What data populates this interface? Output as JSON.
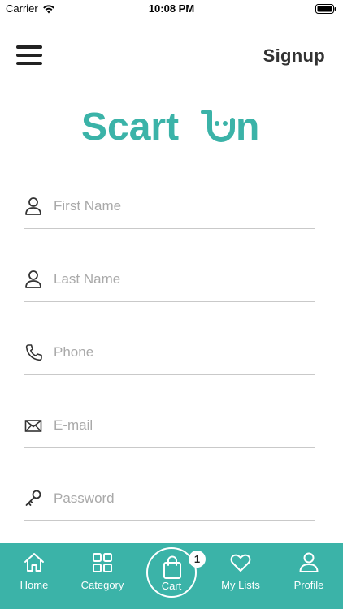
{
  "status_bar": {
    "carrier": "Carrier",
    "time": "10:08 PM"
  },
  "header": {
    "title": "Signup",
    "menu_icon": "hamburger-menu-icon"
  },
  "logo": {
    "text": "Scartᴗn"
  },
  "form": {
    "fields": [
      {
        "icon": "person-icon",
        "placeholder": "First Name",
        "value": ""
      },
      {
        "icon": "person-icon",
        "placeholder": "Last Name",
        "value": ""
      },
      {
        "icon": "phone-icon",
        "placeholder": "Phone",
        "value": ""
      },
      {
        "icon": "envelope-icon",
        "placeholder": "E-mail",
        "value": ""
      },
      {
        "icon": "key-icon",
        "placeholder": "Password",
        "value": ""
      }
    ]
  },
  "tabbar": {
    "tabs": [
      {
        "label": "Home",
        "icon": "home-icon"
      },
      {
        "label": "Category",
        "icon": "grid-icon"
      },
      {
        "label": "Cart",
        "icon": "shopping-bag-icon"
      },
      {
        "label": "My Lists",
        "icon": "heart-icon"
      },
      {
        "label": "Profile",
        "icon": "person-icon"
      }
    ],
    "cart_badge": "1"
  },
  "colors": {
    "brand": "#3bb3a8",
    "text": "#333333",
    "placeholder": "#a9a9a9",
    "divider": "#c9c9c9"
  }
}
